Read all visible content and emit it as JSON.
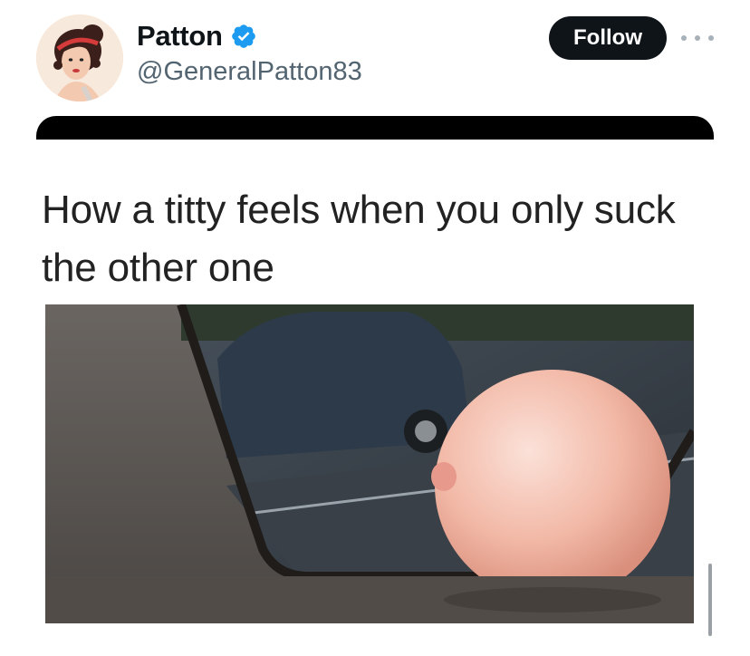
{
  "post": {
    "author": {
      "display_name": "Patton",
      "handle": "@GeneralPatton83",
      "verified": true,
      "avatar_icon": "avatar-image"
    },
    "follow_label": "Follow",
    "more_icon": "more-options-icon",
    "media": {
      "caption": "How a titty feels when you only suck the other one",
      "image_description_icon": "meme-photo"
    }
  },
  "colors": {
    "follow_bg": "#0f1419",
    "verified_blue": "#1d9bf0",
    "handle_gray": "#536471"
  }
}
